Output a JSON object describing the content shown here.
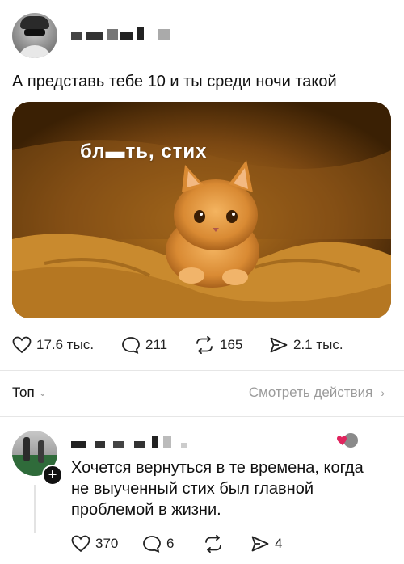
{
  "post": {
    "text": "А представь тебе 10 и ты среди ночи такой",
    "image_caption": "бл▬ть, стих",
    "stats": {
      "likes": "17.6 тыс.",
      "comments": "211",
      "reposts": "165",
      "shares": "2.1 тыс."
    }
  },
  "replies_header": {
    "sort_label": "Топ",
    "view_activity_label": "Смотреть действия"
  },
  "comment": {
    "lines": [
      "Хочется вернуться в те времена, когда",
      "не выученный стих был главной",
      "проблемой в жизни."
    ],
    "stats": {
      "likes": "370",
      "comments": "6",
      "shares": "4"
    }
  },
  "colors": {
    "text": "#111111",
    "muted": "#9b9b9b",
    "like_heart": "#e0245e"
  },
  "icons": [
    "heart-icon",
    "comment-icon",
    "repost-icon",
    "share-icon",
    "chevron-down-icon",
    "chevron-right-icon",
    "plus-icon"
  ]
}
